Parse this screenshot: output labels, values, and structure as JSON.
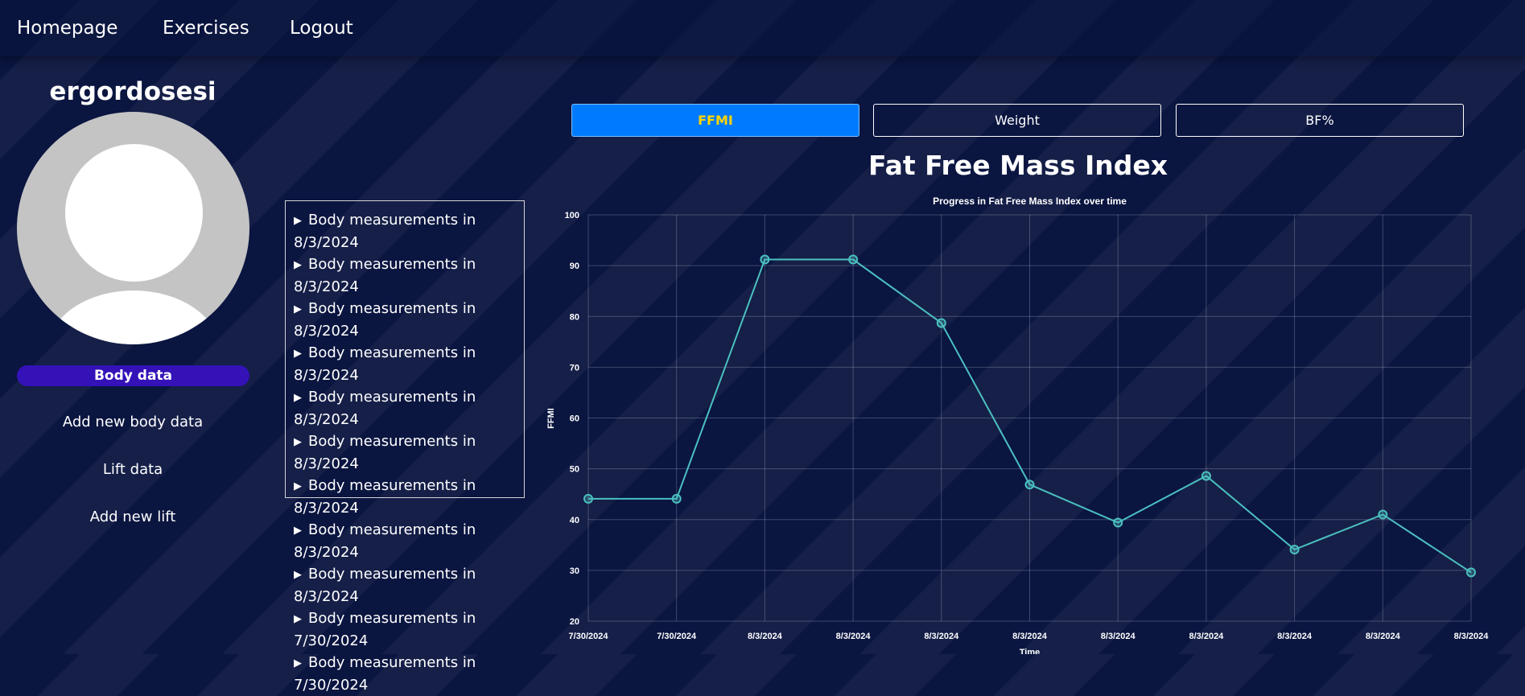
{
  "nav": {
    "homepage": "Homepage",
    "exercises": "Exercises",
    "logout": "Logout"
  },
  "profile": {
    "username": "ergordosesi",
    "body_data_label": "Body data",
    "add_body_data_label": "Add new body data",
    "lift_data_label": "Lift data",
    "add_lift_label": "Add new lift"
  },
  "measurements": [
    {
      "label": "Body measurements in 8/3/2024"
    },
    {
      "label": "Body measurements in 8/3/2024"
    },
    {
      "label": "Body measurements in 8/3/2024"
    },
    {
      "label": "Body measurements in 8/3/2024"
    },
    {
      "label": "Body measurements in 8/3/2024"
    },
    {
      "label": "Body measurements in 8/3/2024"
    },
    {
      "label": "Body measurements in 8/3/2024"
    },
    {
      "label": "Body measurements in 8/3/2024"
    },
    {
      "label": "Body measurements in 8/3/2024"
    },
    {
      "label": "Body measurements in 7/30/2024"
    },
    {
      "label": "Body measurements in 7/30/2024"
    }
  ],
  "tabs": [
    {
      "label": "FFMI",
      "active": true
    },
    {
      "label": "Weight",
      "active": false
    },
    {
      "label": "BF%",
      "active": false
    }
  ],
  "chart_heading": "Fat Free Mass Index",
  "colors": {
    "background": "#0a1540",
    "tab_active": "#007bff",
    "tab_active_text": "#ffd600",
    "body_data_button": "#3412b8",
    "line": "#4bc0c0"
  },
  "chart_data": {
    "type": "line",
    "title": "Progress in Fat Free Mass Index over time",
    "xlabel": "Time",
    "ylabel": "FFMI",
    "ylim": [
      20,
      100
    ],
    "yticks": [
      20,
      30,
      40,
      50,
      60,
      70,
      80,
      90,
      100
    ],
    "grid": true,
    "categories": [
      "7/30/2024",
      "7/30/2024",
      "8/3/2024",
      "8/3/2024",
      "8/3/2024",
      "8/3/2024",
      "8/3/2024",
      "8/3/2024",
      "8/3/2024",
      "8/3/2024",
      "8/3/2024"
    ],
    "series": [
      {
        "values": [
          44.1,
          44.1,
          91.2,
          91.2,
          78.7,
          46.9,
          39.4,
          48.6,
          34.1,
          41.0,
          29.6
        ]
      }
    ]
  }
}
